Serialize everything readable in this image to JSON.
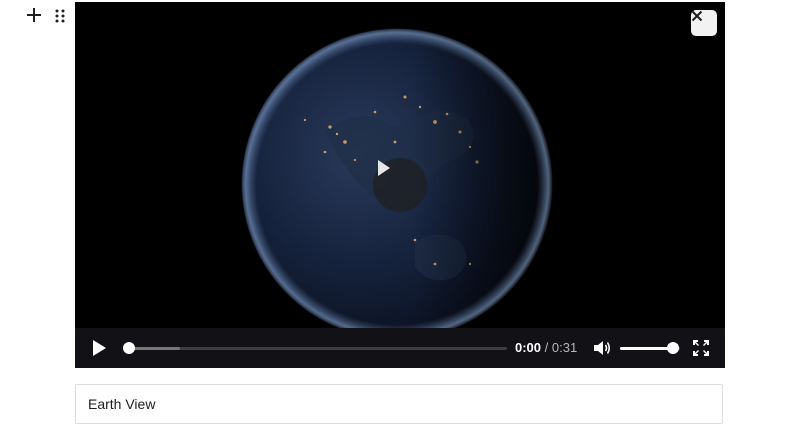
{
  "toolbar": {
    "add_icon": "plus-icon",
    "drag_icon": "drag-handle-icon"
  },
  "player": {
    "close_icon": "close-icon",
    "big_play_icon": "play-icon",
    "controls": {
      "play_icon": "play-icon",
      "progress_fraction": 0.0,
      "buffered_fraction": 0.14,
      "current_time": "0:00",
      "separator": "/",
      "duration": "0:31",
      "volume_icon": "volume-icon",
      "volume_fraction": 0.88,
      "fullscreen_icon": "fullscreen-icon"
    }
  },
  "caption": {
    "value": "Earth View"
  }
}
